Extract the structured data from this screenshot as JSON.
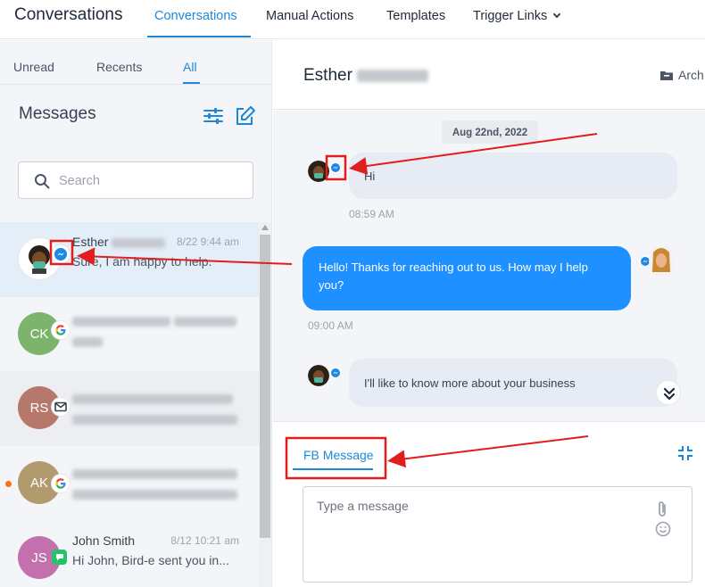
{
  "topnav": {
    "app_title": "Conversations",
    "tabs": [
      {
        "label": "Conversations"
      },
      {
        "label": "Manual Actions"
      },
      {
        "label": "Templates"
      },
      {
        "label": "Trigger Links"
      }
    ]
  },
  "left": {
    "tabs": [
      {
        "label": "Unread"
      },
      {
        "label": "Recents"
      },
      {
        "label": "All"
      }
    ],
    "title": "Messages",
    "search_placeholder": "Search",
    "conversations": [
      {
        "name": "Esther",
        "time": "8/22 9:44 am",
        "preview": "Sure, I am happy to help.",
        "channel": "messenger-icon"
      },
      {
        "initials": "CK",
        "avatar_color": "#7db46c",
        "channel": "google-icon"
      },
      {
        "initials": "RS",
        "avatar_color": "#b5786b",
        "channel": "email-icon"
      },
      {
        "initials": "AK",
        "avatar_color": "#b29a6f",
        "channel": "google-icon"
      },
      {
        "initials": "JS",
        "avatar_color": "#c271ad",
        "name": "John Smith",
        "time": "8/12 10:21 am",
        "preview": "Hi John, Bird-e sent you in...",
        "channel": "sms-icon"
      }
    ]
  },
  "chat": {
    "contact_name": "Esther",
    "archive_label": "Arch",
    "date_label": "Aug 22nd, 2022",
    "messages": [
      {
        "direction": "in",
        "text": "Hi",
        "time": "08:59 AM"
      },
      {
        "direction": "out",
        "text": "Hello! Thanks for reaching out to us. How may I help you?",
        "time": "09:00 AM"
      },
      {
        "direction": "in",
        "text": "I'll like to know more about your business"
      }
    ],
    "composer": {
      "tab_label": "FB Message",
      "placeholder": "Type a message"
    }
  },
  "colors": {
    "accent": "#1e88d8",
    "outgoing_bubble": "#1e90ff",
    "annotation": "#e11d1d"
  }
}
